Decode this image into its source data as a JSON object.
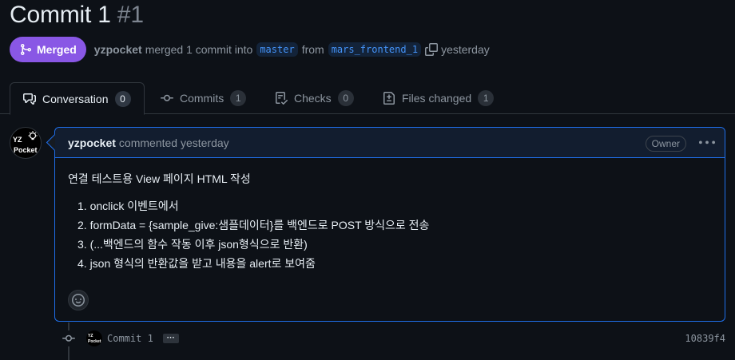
{
  "pr": {
    "title": "Commit 1",
    "number": "#1"
  },
  "meta": {
    "status": "Merged",
    "author": "yzpocket",
    "action": "merged 1 commit into",
    "base_branch": "master",
    "from_text": "from",
    "head_branch": "mars_frontend_1",
    "time": "yesterday"
  },
  "tabs": [
    {
      "label": "Conversation",
      "count": "0",
      "icon": "comment-discussion-icon"
    },
    {
      "label": "Commits",
      "count": "1",
      "icon": "git-commit-icon"
    },
    {
      "label": "Checks",
      "count": "0",
      "icon": "checklist-icon"
    },
    {
      "label": "Files changed",
      "count": "1",
      "icon": "file-diff-icon"
    }
  ],
  "avatar": {
    "line1": "YZ",
    "line2": "Pocket"
  },
  "comment": {
    "author": "yzpocket",
    "action": "commented yesterday",
    "role": "Owner",
    "heading": "연결 테스트용 View 페이지 HTML 작성",
    "items": [
      "1. onclick 이벤트에서",
      "2. formData = {sample_give:샘플데이터}를 백엔드로 POST 방식으로 전송",
      "3. (...백엔드의 함수 작동 이후 json형식으로 반환)",
      "4. json 형식의 반환값을 받고 내용을 alert로 보여줌"
    ]
  },
  "commit": {
    "message": "Commit 1",
    "ellipsis": "···",
    "sha": "10839f4"
  },
  "colors": {
    "merged": "#8957e5",
    "accent_border": "#1f6feb",
    "branch_text": "#4493f8",
    "background": "#0d1117"
  }
}
